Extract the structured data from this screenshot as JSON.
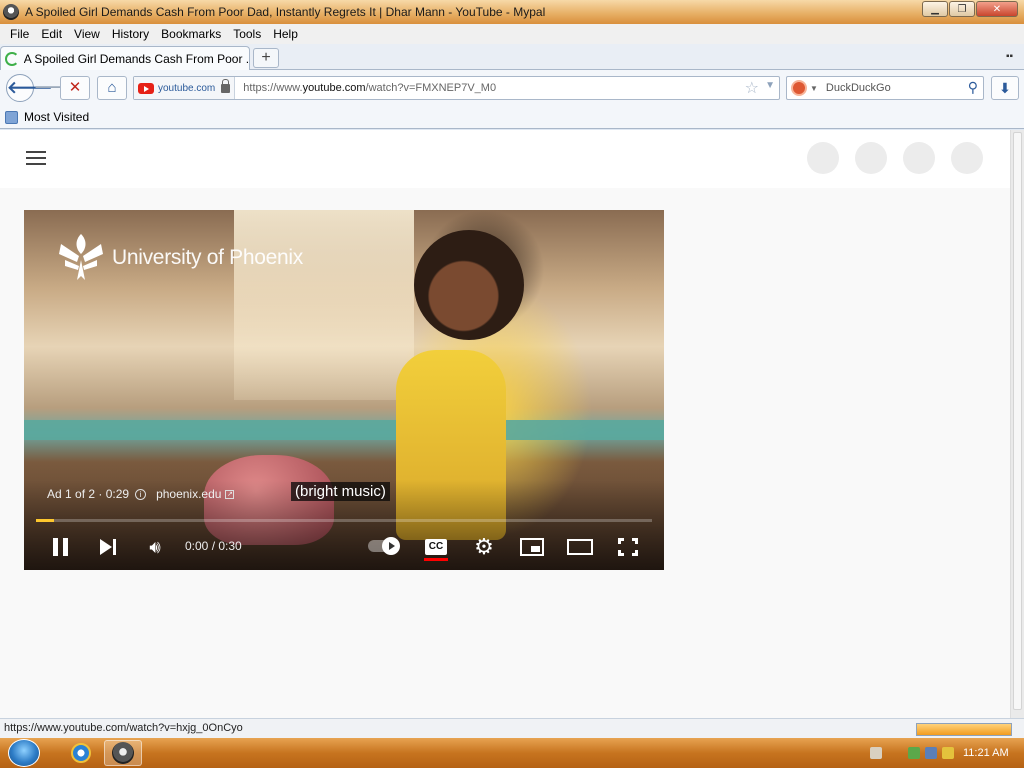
{
  "window": {
    "title": "A Spoiled Girl Demands Cash From Poor Dad, Instantly Regrets It | Dhar Mann - YouTube - Mypal"
  },
  "menu": [
    "File",
    "Edit",
    "View",
    "History",
    "Bookmarks",
    "Tools",
    "Help"
  ],
  "tab": {
    "title": "A Spoiled Girl Demands Cash From Poor ...",
    "new_tab_label": "+"
  },
  "navbar": {
    "site_name": "youtube.com",
    "url_prefix": "https://www.",
    "url_host": "youtube.com",
    "url_path": "/watch?v=FMXNEP7V_M0",
    "search_placeholder": "DuckDuckGo"
  },
  "bookmarks": {
    "most_visited": "Most Visited"
  },
  "player": {
    "brand": "University of Phoenix",
    "ad_label": "Ad 1 of 2 · 0:29",
    "ad_link": "phoenix.edu",
    "caption": "(bright music)",
    "time": "0:00 / 0:30",
    "progress": 0.03,
    "cc_label": "CC"
  },
  "status": {
    "url": "https://www.youtube.com/watch?v=hxjg_0OnCyo"
  },
  "taskbar": {
    "clock": "11:21 AM"
  },
  "colors": {
    "accent_progress": "#fdc72e",
    "cc_active": "#ff0000",
    "youtube_red": "#e62117"
  }
}
